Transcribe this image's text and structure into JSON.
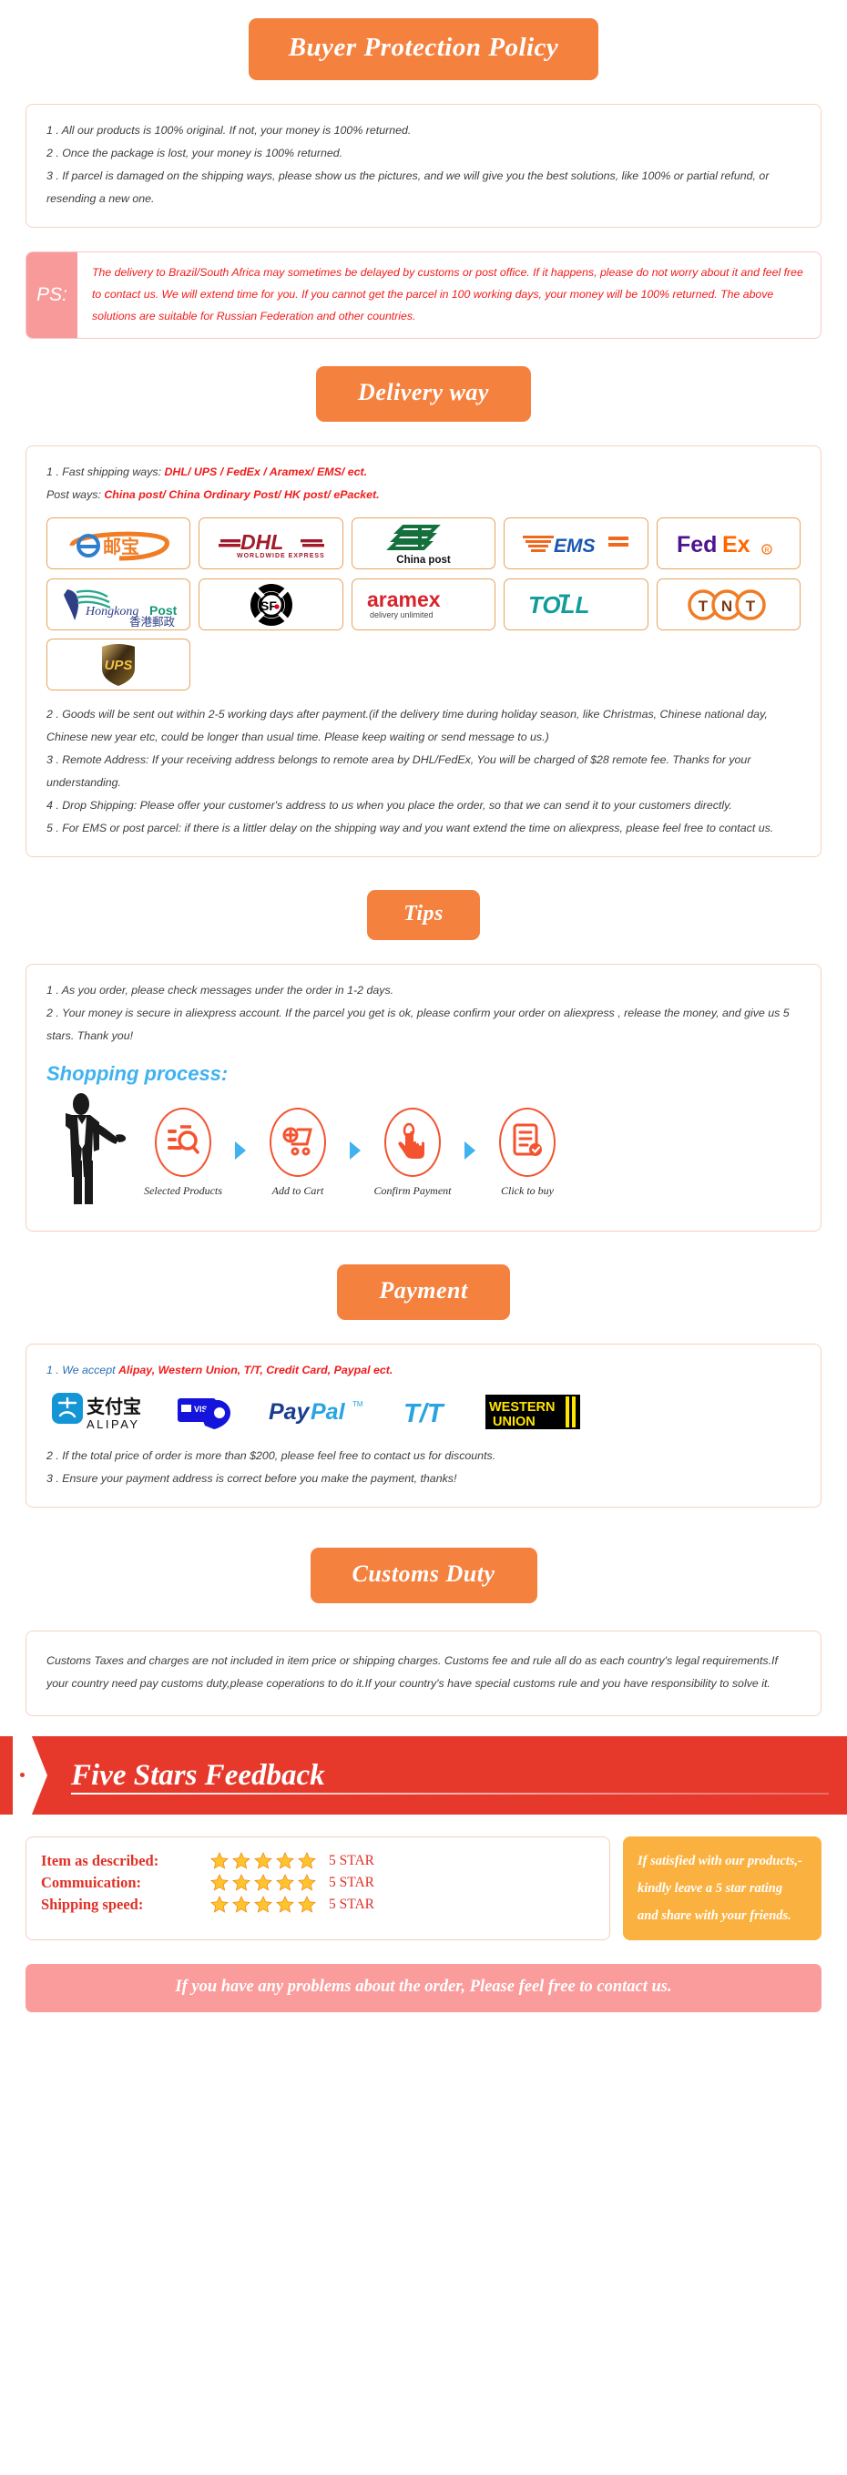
{
  "buyer_protection": {
    "heading": "Buyer Protection Policy",
    "items": [
      "1 . All our products is 100% original. If not, your money is 100% returned.",
      "2 . Once the package is lost, your money is 100% returned.",
      "3 . If parcel is damaged on the shipping ways, please show us the pictures, and we will give you the best solutions, like 100% or partial refund, or resending a new one."
    ]
  },
  "ps": {
    "label": "PS:",
    "text": "The delivery to Brazil/South Africa may sometimes be delayed by customs or post office. If it happens, please do not worry about it and feel free to contact us. We will extend time for you. If you cannot get the parcel in 100 working days, your money will be 100% returned. The above solutions are suitable for Russian Federation and other countries."
  },
  "delivery": {
    "heading": "Delivery way",
    "line1_prefix": "1 . Fast shipping ways: ",
    "line1_red": "DHL/ UPS / FedEx / Aramex/ EMS/ ect.",
    "line2_prefix": "Post ways: ",
    "line2_red": "China post/ China Ordinary Post/ HK post/ ePacket.",
    "carriers": [
      {
        "name": "epacket-logo",
        "label": "e邮宝"
      },
      {
        "name": "dhl-logo",
        "label": "DHL"
      },
      {
        "name": "china-post-logo",
        "label": "China post"
      },
      {
        "name": "ems-logo",
        "label": "EMS"
      },
      {
        "name": "fedex-logo",
        "label": "FedEx"
      },
      {
        "name": "hongkong-post-logo",
        "label": "Hongkong Post 香港郵政"
      },
      {
        "name": "sf-express-logo",
        "label": "SF"
      },
      {
        "name": "aramex-logo",
        "label": "aramex delivery unlimited"
      },
      {
        "name": "toll-logo",
        "label": "TOLL"
      },
      {
        "name": "tnt-logo",
        "label": "TNT"
      },
      {
        "name": "ups-logo",
        "label": "UPS"
      }
    ],
    "items": [
      "2 . Goods will be sent out within 2-5 working days after payment.(if the delivery time during holiday season, like Christmas, Chinese national day, Chinese new year etc, could be longer than usual time. Please keep waiting or send message to us.)",
      "3 . Remote Address: If your receiving address belongs to remote area by DHL/FedEx, You will be charged of $28 remote fee. Thanks for your understanding.",
      "4 . Drop Shipping: Please offer your customer's address to us when you place the order, so that we can send it to your customers directly.",
      "5 . For EMS or post parcel: if there is a littler delay on the shipping way and you want extend the time on aliexpress, please feel free to contact us."
    ]
  },
  "tips": {
    "heading": "Tips",
    "items": [
      "1 .  As you order, please check messages under the order in 1-2 days.",
      "2 . Your money is secure in aliexpress account. If the parcel you get is ok, please confirm your order on aliexpress , release the money, and give us 5 stars. Thank you!"
    ],
    "shopping_process_title": "Shopping process:",
    "steps": [
      {
        "icon": "search-list-icon",
        "label": "Selected Products"
      },
      {
        "icon": "shopping-cart-icon",
        "label": "Add to Cart"
      },
      {
        "icon": "hand-click-icon",
        "label": "Confirm Payment"
      },
      {
        "icon": "document-check-icon",
        "label": "Click to buy"
      }
    ]
  },
  "payment": {
    "heading": "Payment",
    "line1_prefix": "1 . We accept ",
    "line1_red": "Alipay, Western Union, T/T, Credit Card, Paypal ect.",
    "methods": [
      {
        "name": "alipay-logo",
        "label": "支付宝 ALIPAY"
      },
      {
        "name": "credit-card-logo",
        "label": "VISA"
      },
      {
        "name": "paypal-logo",
        "label": "PayPal"
      },
      {
        "name": "tt-logo",
        "label": "T/T"
      },
      {
        "name": "western-union-logo",
        "label": "WESTERN UNION"
      }
    ],
    "items": [
      "2 . If the total price of order is more than $200, please feel free to contact us for discounts.",
      "3 . Ensure your payment address is correct before you make the payment, thanks!"
    ]
  },
  "customs": {
    "heading": "Customs Duty",
    "text": "Customs Taxes and charges are not included in item price or shipping charges. Customs fee and rule all do as each country's legal requirements.If your country need pay customs duty,please coperations to do it.If your country's have special customs rule and you have responsibility to solve it."
  },
  "feedback": {
    "banner_title": "Five Stars Feedback",
    "rows": [
      {
        "label": "Item as described:",
        "stars": 5,
        "value": "5 STAR"
      },
      {
        "label": "Commuication:",
        "stars": 5,
        "value": "5 STAR"
      },
      {
        "label": "Shipping speed:",
        "stars": 5,
        "value": "5 STAR"
      }
    ],
    "note_lines": [
      "If satisfied with our products,-",
      "kindly leave a 5 star rating",
      "and share with your friends."
    ],
    "contact_bar": "If you have any problems about the order, Please feel free to contact us."
  },
  "colors": {
    "pill_orange": "#f5813f",
    "banner_red": "#e7382c",
    "ps_pink": "#f89a9a",
    "note_amber": "#fbb13f",
    "contact_pink": "#fb9c9c",
    "link_red": "#f21b1b",
    "shopping_blue": "#3fb2ef",
    "star_gold": "#fdc42c",
    "process_red": "#f4532f"
  }
}
